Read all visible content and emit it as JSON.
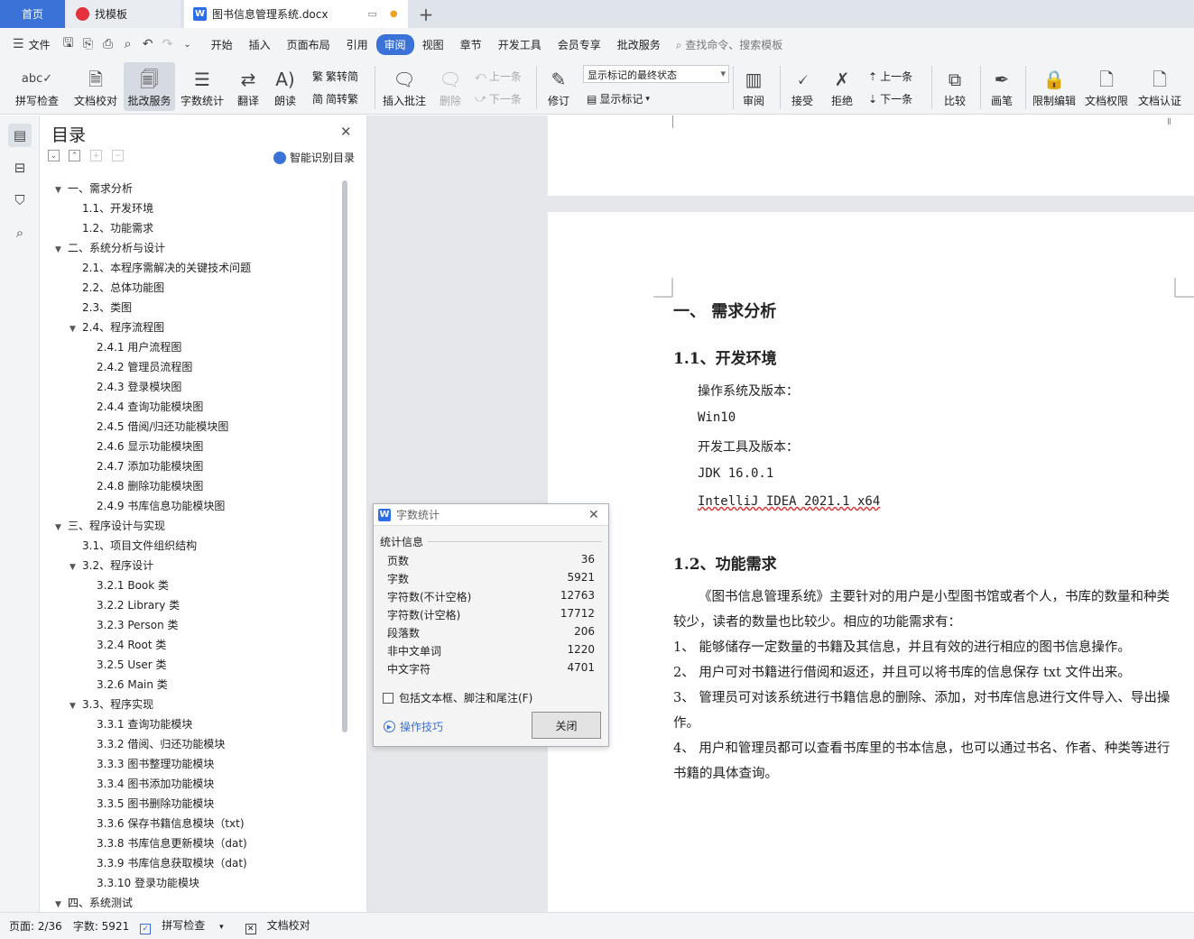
{
  "tabs": {
    "home": "首页",
    "template": "找模板",
    "document": "图书信息管理系统.docx",
    "new_tab": "+"
  },
  "menu": {
    "file": "文件",
    "items": [
      "开始",
      "插入",
      "页面布局",
      "引用",
      "审阅",
      "视图",
      "章节",
      "开发工具",
      "会员专享",
      "批改服务"
    ],
    "active": "审阅",
    "search_placeholder": "查找命令、搜索模板"
  },
  "ribbon": {
    "spell_check": "拼写检查",
    "doc_proof": "文档校对",
    "grading": "批改服务",
    "word_count": "字数统计",
    "translate": "翻译",
    "read_aloud": "朗读",
    "trad": "繁转简",
    "simp": "简转繁",
    "insert_comment": "插入批注",
    "delete": "删除",
    "prev_comment": "上一条",
    "next_comment": "下一条",
    "revise": "修订",
    "mark_state": "显示标记的最终状态",
    "show_marks": "显示标记",
    "review": "审阅",
    "accept": "接受",
    "reject": "拒绝",
    "prev": "上一条",
    "next": "下一条",
    "compare": "比较",
    "pen": "画笔",
    "restrict_edit": "限制编辑",
    "doc_permission": "文档权限",
    "doc_cert": "文档认证",
    "selected": "批改服务"
  },
  "toc": {
    "title": "目录",
    "smart_label": "智能识别目录",
    "items": [
      {
        "text": "一、需求分析",
        "level": 1,
        "arrow": true
      },
      {
        "text": "1.1、开发环境",
        "level": 2,
        "arrow": false
      },
      {
        "text": "1.2、功能需求",
        "level": 2,
        "arrow": false
      },
      {
        "text": "二、系统分析与设计",
        "level": 1,
        "arrow": true
      },
      {
        "text": "2.1、本程序需解决的关键技术问题",
        "level": 2,
        "arrow": false
      },
      {
        "text": "2.2、总体功能图",
        "level": 2,
        "arrow": false
      },
      {
        "text": "2.3、类图",
        "level": 2,
        "arrow": false
      },
      {
        "text": "2.4、程序流程图",
        "level": 2,
        "arrow": true
      },
      {
        "text": "2.4.1  用户流程图",
        "level": 3,
        "arrow": false
      },
      {
        "text": "2.4.2  管理员流程图",
        "level": 3,
        "arrow": false
      },
      {
        "text": "2.4.3  登录模块图",
        "level": 3,
        "arrow": false
      },
      {
        "text": "2.4.4  查询功能模块图",
        "level": 3,
        "arrow": false
      },
      {
        "text": "2.4.5 借阅/归还功能模块图",
        "level": 3,
        "arrow": false
      },
      {
        "text": "2.4.6 显示功能模块图",
        "level": 3,
        "arrow": false
      },
      {
        "text": "2.4.7 添加功能模块图",
        "level": 3,
        "arrow": false
      },
      {
        "text": "2.4.8 删除功能模块图",
        "level": 3,
        "arrow": false
      },
      {
        "text": "2.4.9  书库信息功能模块图",
        "level": 3,
        "arrow": false
      },
      {
        "text": "三、程序设计与实现",
        "level": 1,
        "arrow": true
      },
      {
        "text": "3.1、项目文件组织结构",
        "level": 2,
        "arrow": false
      },
      {
        "text": "3.2、程序设计",
        "level": 2,
        "arrow": true
      },
      {
        "text": "3.2.1 Book 类",
        "level": 3,
        "arrow": false
      },
      {
        "text": "3.2.2 Library 类",
        "level": 3,
        "arrow": false
      },
      {
        "text": "3.2.3 Person 类",
        "level": 3,
        "arrow": false
      },
      {
        "text": "3.2.4    Root 类",
        "level": 3,
        "arrow": false
      },
      {
        "text": "3.2.5 User 类",
        "level": 3,
        "arrow": false
      },
      {
        "text": "3.2.6 Main 类",
        "level": 3,
        "arrow": false
      },
      {
        "text": "3.3、程序实现",
        "level": 2,
        "arrow": true
      },
      {
        "text": "3.3.1 查询功能模块",
        "level": 3,
        "arrow": false
      },
      {
        "text": "3.3.2 借阅、归还功能模块",
        "level": 3,
        "arrow": false
      },
      {
        "text": "3.3.3  图书整理功能模块",
        "level": 3,
        "arrow": false
      },
      {
        "text": "3.3.4  图书添加功能模块",
        "level": 3,
        "arrow": false
      },
      {
        "text": "3.3.5  图书删除功能模块",
        "level": 3,
        "arrow": false
      },
      {
        "text": "3.3.6 保存书籍信息模块（txt)",
        "level": 3,
        "arrow": false
      },
      {
        "text": "3.3.8 书库信息更新模块（dat)",
        "level": 3,
        "arrow": false
      },
      {
        "text": "3.3.9 书库信息获取模块（dat)",
        "level": 3,
        "arrow": false
      },
      {
        "text": "3.3.10  登录功能模块",
        "level": 3,
        "arrow": false
      },
      {
        "text": "四、系统测试",
        "level": 1,
        "arrow": true
      }
    ]
  },
  "document": {
    "h1": "一、     需求分析",
    "h2_1": "1.1、开发环境",
    "os_label": "操作系统及版本：",
    "os_value": "Win10",
    "tool_label": "开发工具及版本：",
    "jdk": "JDK 16.0.1",
    "ide": "IntelliJ IDEA 2021.1 x64",
    "h2_2": "1.2、功能需求",
    "intro": "《图书信息管理系统》主要针对的用户是小型图书馆或者个人，书库的数量和种类较少，读者的数量也比较少。相应的功能需求有：",
    "req1": "1、  能够储存一定数量的书籍及其信息，并且有效的进行相应的图书信息操作。",
    "req2": "2、  用户可对书籍进行借阅和返还，并且可以将书库的信息保存 txt 文件出来。",
    "req3": "3、  管理员可对该系统进行书籍信息的删除、添加，对书库信息进行文件导入、导出操作。",
    "req4": "4、  用户和管理员都可以查看书库里的书本信息，也可以通过书名、作者、种类等进行书籍的具体查询。"
  },
  "dialog": {
    "title": "字数统计",
    "group": "统计信息",
    "stats": [
      {
        "label": "页数",
        "value": "36"
      },
      {
        "label": "字数",
        "value": "5921"
      },
      {
        "label": "字符数(不计空格)",
        "value": "12763"
      },
      {
        "label": "字符数(计空格)",
        "value": "17712"
      },
      {
        "label": "段落数",
        "value": "206"
      },
      {
        "label": "非中文单词",
        "value": "1220"
      },
      {
        "label": "中文字符",
        "value": "4701"
      }
    ],
    "checkbox": "包括文本框、脚注和尾注(F)",
    "checkbox_checked": false,
    "tips": "操作技巧",
    "close": "关闭"
  },
  "status": {
    "page": "页面: 2/36",
    "words": "字数: 5921",
    "spell": "拼写检查",
    "proof": "文档校对"
  },
  "colors": {
    "accent": "#3a72d8",
    "tabbar": "#dfe3ea",
    "doc_bg": "#e6e7ea"
  }
}
